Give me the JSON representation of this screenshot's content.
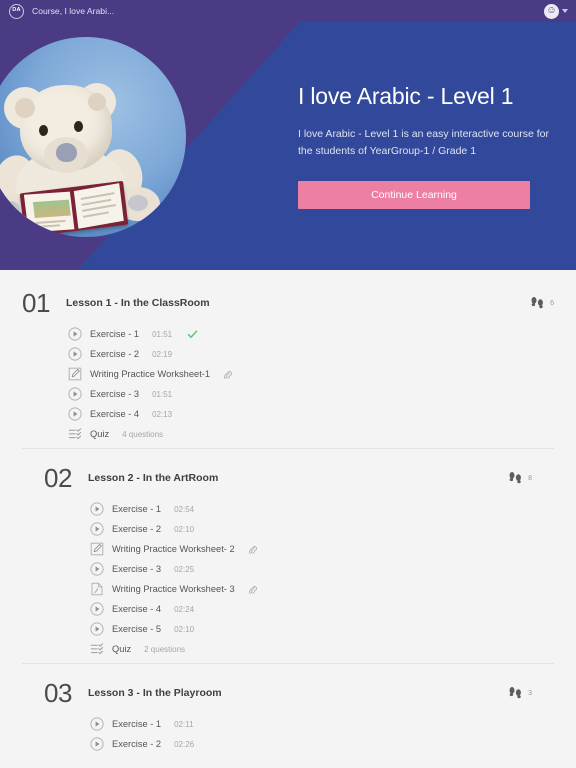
{
  "topbar": {
    "logo_text": "DA",
    "logo_icon": "da-circle-logo",
    "title": "Course, I love Arabi...",
    "avatar_icon": "smiley-avatar-icon",
    "caret_icon": "chevron-down-icon"
  },
  "hero": {
    "photo_alt": "teddy-bear-reading-book",
    "title": "I love Arabic - Level 1",
    "description": "I love Arabic - Level 1 is an easy interactive course for the students of YearGroup-1 / Grade 1",
    "cta_label": "Continue Learning",
    "colors": {
      "purple": "#4a3b84",
      "blue": "#32499b",
      "pink": "#ed7fa5"
    }
  },
  "lessons": [
    {
      "number": "01",
      "title": "Lesson 1 - In the ClassRoom",
      "steps_icon": "footprints-icon",
      "steps_count": "6",
      "items": [
        {
          "icon": "play-circle-icon",
          "label": "Exercise - 1",
          "meta": "01:51",
          "completed": true,
          "clip": false
        },
        {
          "icon": "play-circle-icon",
          "label": "Exercise - 2",
          "meta": "02:19",
          "completed": false,
          "clip": false
        },
        {
          "icon": "pencil-square-icon",
          "label": "Writing Practice Worksheet-1",
          "meta": "",
          "completed": false,
          "clip": true
        },
        {
          "icon": "play-circle-icon",
          "label": "Exercise - 3",
          "meta": "01:51",
          "completed": false,
          "clip": false
        },
        {
          "icon": "play-circle-icon",
          "label": "Exercise - 4",
          "meta": "02:13",
          "completed": false,
          "clip": false
        },
        {
          "icon": "checklist-icon",
          "label": "Quiz",
          "meta": "4 questions",
          "completed": false,
          "clip": false
        }
      ]
    },
    {
      "number": "02",
      "title": "Lesson 2 - In the ArtRoom",
      "steps_icon": "footprints-icon",
      "steps_count": "8",
      "items": [
        {
          "icon": "play-circle-icon",
          "label": "Exercise - 1",
          "meta": "02:54",
          "completed": false,
          "clip": false
        },
        {
          "icon": "play-circle-icon",
          "label": "Exercise - 2",
          "meta": "02:10",
          "completed": false,
          "clip": false
        },
        {
          "icon": "pencil-square-icon",
          "label": "Writing Practice Worksheet- 2",
          "meta": "",
          "completed": false,
          "clip": true
        },
        {
          "icon": "play-circle-icon",
          "label": "Exercise - 3",
          "meta": "02:25",
          "completed": false,
          "clip": false
        },
        {
          "icon": "pdf-document-icon",
          "label": "Writing Practice Worksheet- 3",
          "meta": "",
          "completed": false,
          "clip": true
        },
        {
          "icon": "play-circle-icon",
          "label": "Exercise - 4",
          "meta": "02:24",
          "completed": false,
          "clip": false
        },
        {
          "icon": "play-circle-icon",
          "label": "Exercise - 5",
          "meta": "02:10",
          "completed": false,
          "clip": false
        },
        {
          "icon": "checklist-icon",
          "label": "Quiz",
          "meta": "2 questions",
          "completed": false,
          "clip": false
        }
      ]
    },
    {
      "number": "03",
      "title": "Lesson 3 - In the Playroom",
      "steps_icon": "footprints-icon",
      "steps_count": "3",
      "items": [
        {
          "icon": "play-circle-icon",
          "label": "Exercise - 1",
          "meta": "02:11",
          "completed": false,
          "clip": false
        },
        {
          "icon": "play-circle-icon",
          "label": "Exercise - 2",
          "meta": "02:26",
          "completed": false,
          "clip": false
        }
      ]
    }
  ]
}
